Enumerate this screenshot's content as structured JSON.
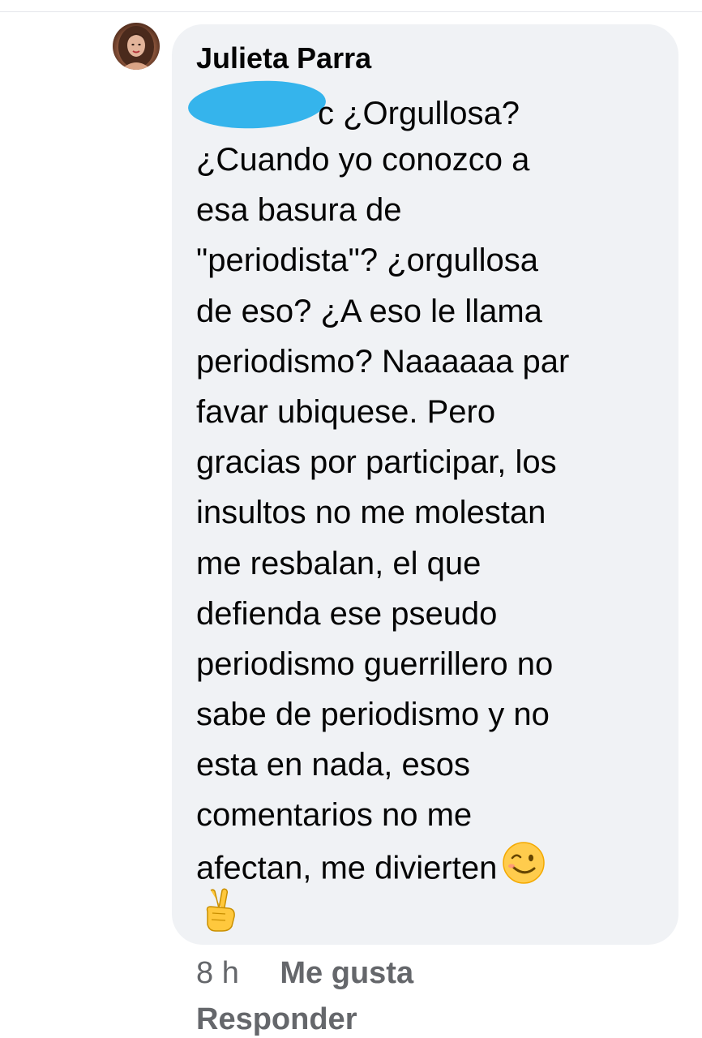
{
  "comment": {
    "author": "Julieta Parra",
    "mention_tail": "c ¿Orgullosa?",
    "lines": [
      "¿Cuando yo conozco a",
      "esa basura de",
      "\"periodista\"? ¿orgullosa",
      "de eso? ¿A eso le llama",
      "periodismo? Naaaaaa par",
      "favar ubiquese. Pero",
      "gracias por participar, los",
      "insultos no me molestan",
      "me resbalan, el que",
      "defienda ese pseudo",
      "periodismo guerrillero no",
      "sabe de periodismo y no",
      "esta en nada, esos",
      "comentarios no me",
      "afectan, me divierten"
    ],
    "emoji_wink": "winking-face-emoji",
    "emoji_victory": "victory-hand-emoji"
  },
  "actions": {
    "time": "8 h",
    "like_label": "Me gusta",
    "reply_label": "Responder"
  },
  "colors": {
    "bubble": "#f0f2f5",
    "text": "#050505",
    "meta": "#65676b",
    "redaction": "#35b4ec"
  }
}
